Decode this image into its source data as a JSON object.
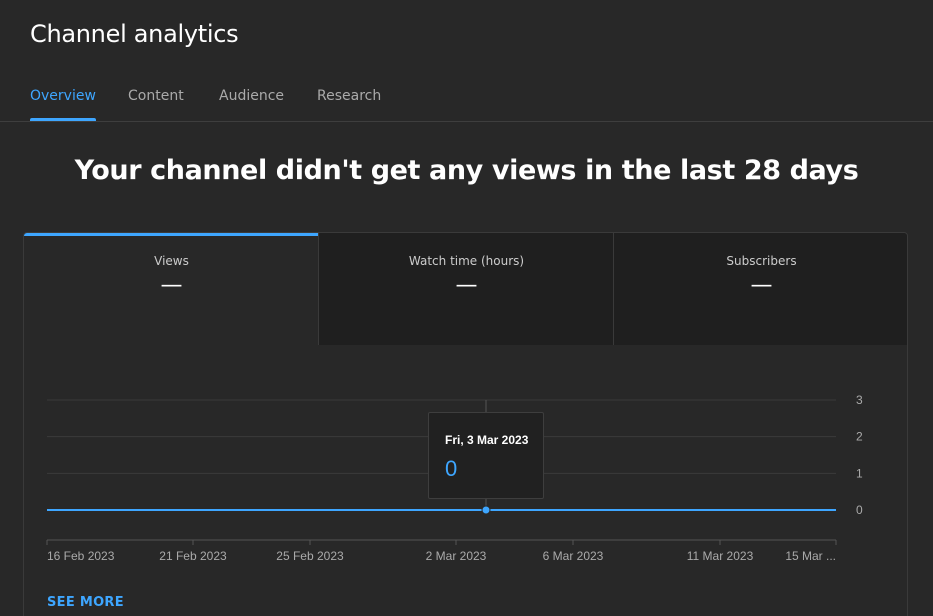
{
  "header": {
    "title": "Channel analytics"
  },
  "tabs": [
    {
      "label": "Overview",
      "active": true
    },
    {
      "label": "Content",
      "active": false
    },
    {
      "label": "Audience",
      "active": false
    },
    {
      "label": "Research",
      "active": false
    }
  ],
  "headline": "Your channel didn't get any views in the last 28 days",
  "metrics": [
    {
      "label": "Views",
      "value": "—",
      "active": true
    },
    {
      "label": "Watch time (hours)",
      "value": "—",
      "active": false
    },
    {
      "label": "Subscribers",
      "value": "—",
      "active": false
    }
  ],
  "tooltip": {
    "date": "Fri, 3 Mar 2023",
    "value": "0"
  },
  "see_more_label": "SEE MORE",
  "colors": {
    "accent": "#3ea6ff",
    "line": "#3ea6ff",
    "background": "#282828"
  },
  "chart_data": {
    "type": "line",
    "x_tick_labels": [
      "16 Feb 2023",
      "21 Feb 2023",
      "25 Feb 2023",
      "2 Mar 2023",
      "6 Mar 2023",
      "11 Mar 2023",
      "15 Mar ..."
    ],
    "y_tick_labels": [
      "0",
      "1",
      "2",
      "3"
    ],
    "ylim": [
      0,
      3
    ],
    "grid": true,
    "series": [
      {
        "values": [
          0,
          0,
          0,
          0,
          0,
          0,
          0
        ]
      }
    ],
    "highlighted_point": {
      "x": "Fri, 3 Mar 2023",
      "y": 0
    }
  }
}
